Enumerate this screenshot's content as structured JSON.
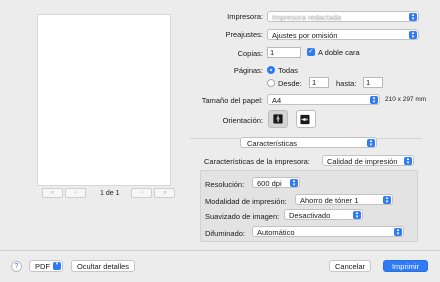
{
  "preview": {
    "page_label": "1 de 1"
  },
  "printer": {
    "label": "Impresora:",
    "value": "Impresora redactada"
  },
  "presets": {
    "label": "Preajustes:",
    "value": "Ajustes por omisión"
  },
  "copies": {
    "label": "Copias:",
    "value": "1",
    "duplex_label": "A doble cara",
    "duplex_checked": true
  },
  "pages": {
    "label": "Páginas:",
    "all_label": "Todas",
    "from_label": "Desde:",
    "from_value": "1",
    "to_label": "hasta:",
    "to_value": "1"
  },
  "paper": {
    "label": "Tamaño del papel:",
    "value": "A4",
    "dimensions": "210 x 297 mm"
  },
  "orientation": {
    "label": "Orientación:"
  },
  "section": {
    "value": "Características"
  },
  "printer_features": {
    "label": "Características de la impresora:",
    "value": "Calidad de impresión"
  },
  "resolution": {
    "label": "Resolución:",
    "value": "600 dpi"
  },
  "print_mode": {
    "label": "Modalidad de impresión:",
    "value": "Ahorro de tóner 1"
  },
  "smoothing": {
    "label": "Suavizado de imagen:",
    "value": "Desactivado"
  },
  "dithering": {
    "label": "Difuminado:",
    "value": "Automático"
  },
  "footer": {
    "help": "?",
    "pdf": "PDF",
    "hide_details": "Ocultar detalles",
    "cancel": "Cancelar",
    "print": "Imprimir"
  },
  "colors": {
    "accent": "#2f7bf5",
    "background": "#ececec"
  }
}
